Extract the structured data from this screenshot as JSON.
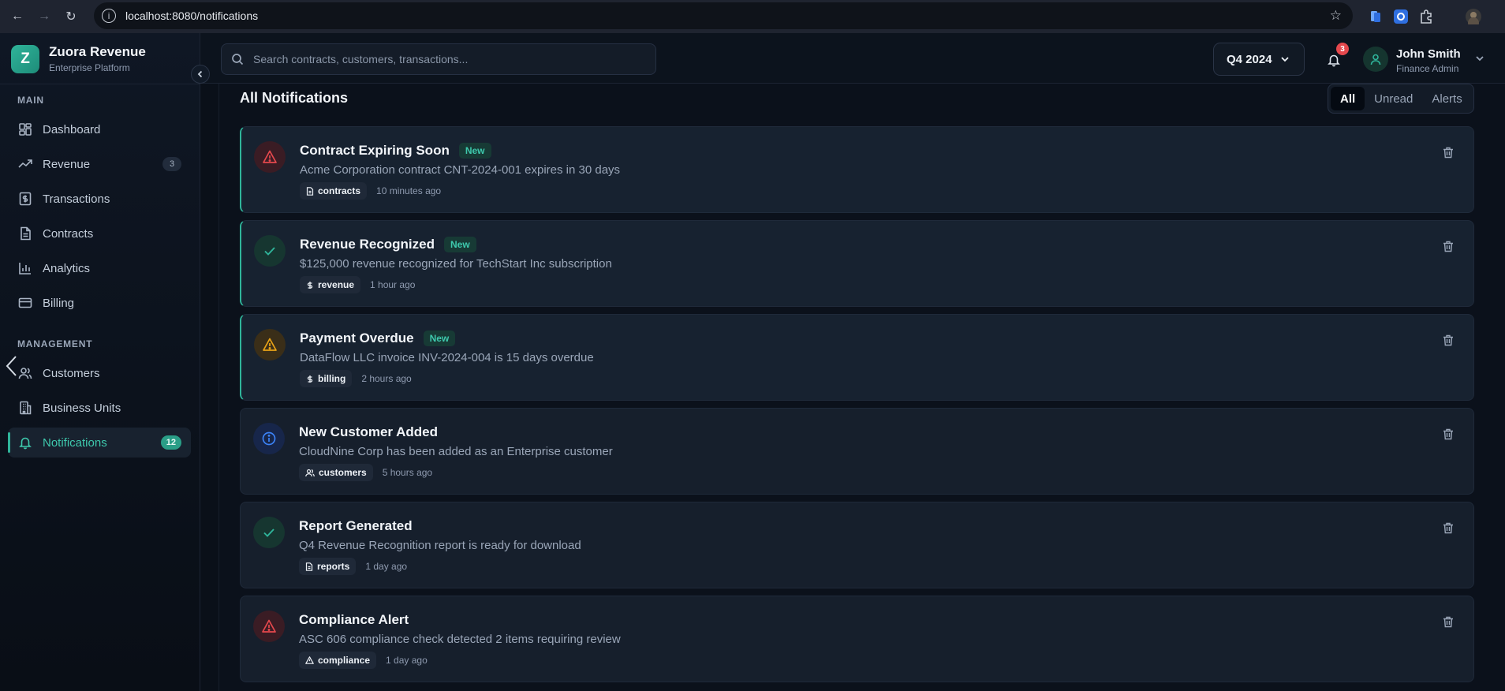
{
  "browser": {
    "url": "localhost:8080/notifications"
  },
  "brand": {
    "logo_letter": "Z",
    "name": "Zuora Revenue",
    "subtitle": "Enterprise Platform"
  },
  "sidebar": {
    "main_label": "MAIN",
    "management_label": "MANAGEMENT",
    "main_items": [
      {
        "label": "Dashboard",
        "icon": "dashboard-icon"
      },
      {
        "label": "Revenue",
        "icon": "trending-up-icon",
        "count": "3"
      },
      {
        "label": "Transactions",
        "icon": "dollar-receipt-icon"
      },
      {
        "label": "Contracts",
        "icon": "document-icon"
      },
      {
        "label": "Analytics",
        "icon": "bar-chart-icon"
      },
      {
        "label": "Billing",
        "icon": "credit-card-icon"
      }
    ],
    "management_items": [
      {
        "label": "Customers",
        "icon": "users-icon"
      },
      {
        "label": "Business Units",
        "icon": "building-icon"
      },
      {
        "label": "Notifications",
        "icon": "bell-icon",
        "count": "12",
        "active": true
      }
    ]
  },
  "header": {
    "search_placeholder": "Search contracts, customers, transactions...",
    "period": "Q4 2024",
    "notification_badge": "3",
    "user_name": "John Smith",
    "user_role": "Finance Admin"
  },
  "notifications_panel": {
    "title": "All Notifications",
    "tabs": [
      "All",
      "Unread",
      "Alerts"
    ],
    "active_tab": "All",
    "new_label": "New",
    "items": [
      {
        "title": "Contract Expiring Soon",
        "message": "Acme Corporation contract CNT-2024-001 expires in 30 days",
        "tag": "contracts",
        "tag_icon": "document-icon",
        "time": "10 minutes ago",
        "icon": "alert-triangle-icon",
        "tone": "#e5484d",
        "is_new": true
      },
      {
        "title": "Revenue Recognized",
        "message": "$125,000 revenue recognized for TechStart Inc subscription",
        "tag": "revenue",
        "tag_icon": "dollar-icon",
        "time": "1 hour ago",
        "icon": "check-icon",
        "tone": "#2fb49a",
        "is_new": true
      },
      {
        "title": "Payment Overdue",
        "message": "DataFlow LLC invoice INV-2024-004 is 15 days overdue",
        "tag": "billing",
        "tag_icon": "dollar-icon",
        "time": "2 hours ago",
        "icon": "warning-triangle-icon",
        "tone": "#e8a317",
        "is_new": true
      },
      {
        "title": "New Customer Added",
        "message": "CloudNine Corp has been added as an Enterprise customer",
        "tag": "customers",
        "tag_icon": "users-icon",
        "time": "5 hours ago",
        "icon": "info-icon",
        "tone": "#3b82f6",
        "is_new": false
      },
      {
        "title": "Report Generated",
        "message": "Q4 Revenue Recognition report is ready for download",
        "tag": "reports",
        "tag_icon": "document-icon",
        "time": "1 day ago",
        "icon": "check-icon",
        "tone": "#2fb49a",
        "is_new": false
      },
      {
        "title": "Compliance Alert",
        "message": "ASC 606 compliance check detected 2 items requiring review",
        "tag": "compliance",
        "tag_icon": "warning-icon",
        "time": "1 day ago",
        "icon": "alert-triangle-icon",
        "tone": "#e5484d",
        "is_new": false
      }
    ]
  },
  "colors": {
    "accent": "#2fb49a",
    "danger": "#e5484d",
    "warning": "#e8a317",
    "info": "#3b82f6"
  }
}
